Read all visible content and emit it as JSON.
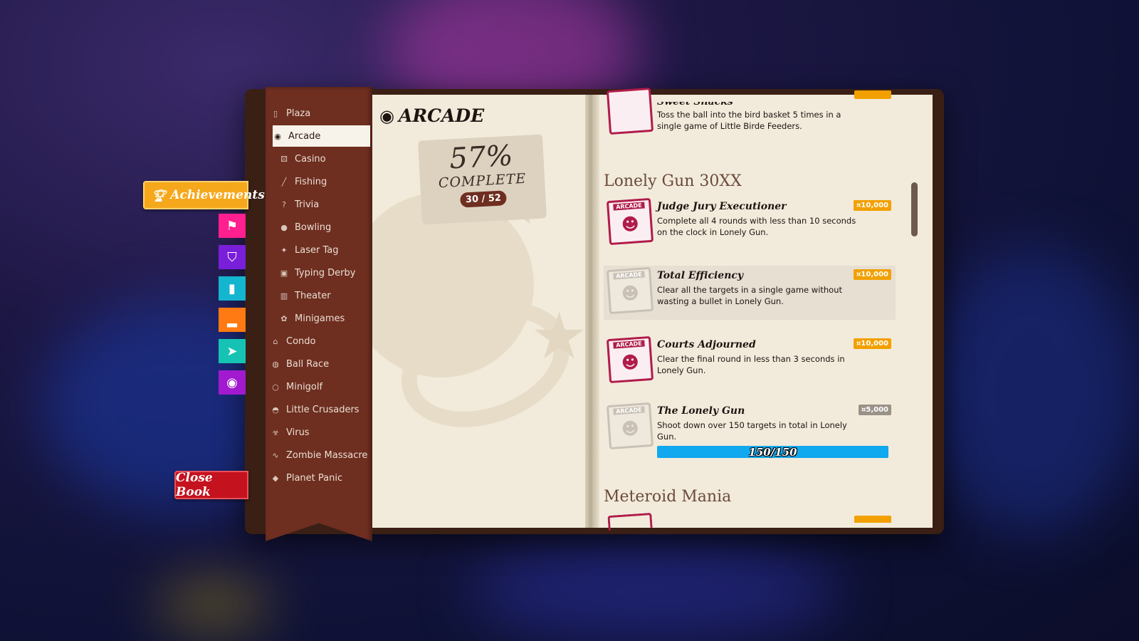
{
  "side_tabs": {
    "achievements_label": "Achievements",
    "close_label": "Close Book",
    "buttons": [
      {
        "name": "flag-icon",
        "color": "#ff1f8e",
        "glyph": "⚑"
      },
      {
        "name": "shield-icon",
        "color": "#7a1fd9",
        "glyph": "⛉"
      },
      {
        "name": "bar-chart-icon",
        "color": "#13b5cf",
        "glyph": "▮"
      },
      {
        "name": "podium-icon",
        "color": "#ff7a12",
        "glyph": "▂"
      },
      {
        "name": "fish-icon",
        "color": "#16c2b3",
        "glyph": "➤"
      },
      {
        "name": "planet-icon",
        "color": "#a11ad0",
        "glyph": "◉"
      }
    ]
  },
  "nav": {
    "items": [
      {
        "label": "Plaza",
        "icon": "plaza-icon",
        "glyph": "▯",
        "sub": false,
        "active": false
      },
      {
        "label": "Arcade",
        "icon": "planet-icon",
        "glyph": "◉",
        "sub": true,
        "active": true
      },
      {
        "label": "Casino",
        "icon": "dice-icon",
        "glyph": "⚄",
        "sub": true,
        "active": false
      },
      {
        "label": "Fishing",
        "icon": "fishing-rod-icon",
        "glyph": "╱",
        "sub": true,
        "active": false
      },
      {
        "label": "Trivia",
        "icon": "question-icon",
        "glyph": "?",
        "sub": true,
        "active": false
      },
      {
        "label": "Bowling",
        "icon": "bowling-ball-icon",
        "glyph": "●",
        "sub": true,
        "active": false
      },
      {
        "label": "Laser Tag",
        "icon": "laser-gun-icon",
        "glyph": "✦",
        "sub": true,
        "active": false
      },
      {
        "label": "Typing Derby",
        "icon": "typing-icon",
        "glyph": "▣",
        "sub": true,
        "active": false
      },
      {
        "label": "Theater",
        "icon": "popcorn-icon",
        "glyph": "▥",
        "sub": true,
        "active": false
      },
      {
        "label": "Minigames",
        "icon": "minigames-icon",
        "glyph": "✿",
        "sub": true,
        "active": false
      },
      {
        "label": "Condo",
        "icon": "house-icon",
        "glyph": "⌂",
        "sub": false,
        "active": false
      },
      {
        "label": "Ball Race",
        "icon": "ball-icon",
        "glyph": "◍",
        "sub": false,
        "active": false
      },
      {
        "label": "Minigolf",
        "icon": "golf-ball-icon",
        "glyph": "○",
        "sub": false,
        "active": false
      },
      {
        "label": "Little Crusaders",
        "icon": "helmet-icon",
        "glyph": "◓",
        "sub": false,
        "active": false
      },
      {
        "label": "Virus",
        "icon": "biohazard-icon",
        "glyph": "☣",
        "sub": false,
        "active": false
      },
      {
        "label": "Zombie Massacre",
        "icon": "heartbeat-icon",
        "glyph": "∿",
        "sub": false,
        "active": false
      },
      {
        "label": "Planet Panic",
        "icon": "cat-icon",
        "glyph": "◆",
        "sub": false,
        "active": false
      }
    ]
  },
  "left_page": {
    "title": "ARCADE",
    "percent": "57%",
    "complete_label": "COMPLETE",
    "count": "30 / 52"
  },
  "right_page": {
    "top_partial": {
      "name": "Sweet Snacks",
      "desc": "Toss the ball into the bird basket 5 times in a single game of Little Birde Feeders."
    },
    "groups": [
      {
        "title": "Lonely Gun 30XX"
      },
      {
        "title": "Meteroid Mania"
      }
    ],
    "achievements": [
      {
        "name": "Judge Jury Executioner",
        "desc": "Complete all 4 rounds with less than 10 seconds on the clock in Lonely Gun.",
        "reward": "¤10,000",
        "badge": "ARCADE",
        "unlocked": true
      },
      {
        "name": "Total Efficiency",
        "desc": "Clear all the targets in a single game without wasting a bullet in Lonely Gun.",
        "reward": "¤10,000",
        "badge": "ARCADE",
        "unlocked": false
      },
      {
        "name": "Courts Adjourned",
        "desc": "Clear the final round in less than 3 seconds in Lonely Gun.",
        "reward": "¤10,000",
        "badge": "ARCADE",
        "unlocked": true
      },
      {
        "name": "The Lonely Gun",
        "desc": "Shoot down over 150 targets in total in Lonely Gun.",
        "reward": "¤5,000",
        "badge": "ARCADE",
        "unlocked": false,
        "progress_text": "150/150",
        "progress_fraction": 1.0
      }
    ]
  }
}
